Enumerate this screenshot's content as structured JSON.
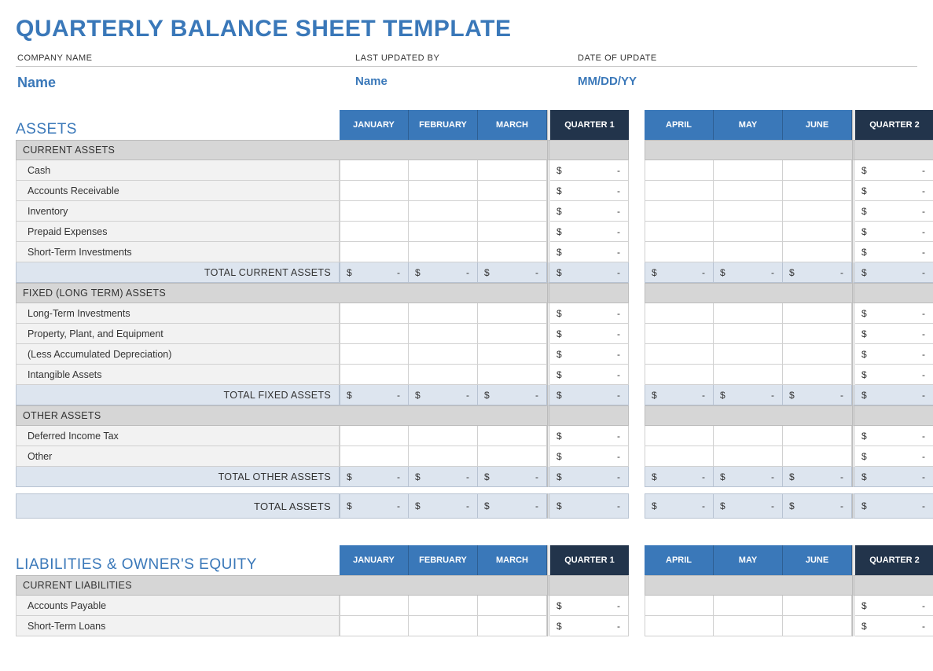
{
  "title": "QUARTERLY BALANCE SHEET TEMPLATE",
  "meta": {
    "labels": {
      "company": "COMPANY NAME",
      "updated_by": "LAST UPDATED BY",
      "date": "DATE OF UPDATE"
    },
    "values": {
      "company": "Name",
      "updated_by": "Name",
      "date": "MM/DD/YY"
    }
  },
  "columns_q1": {
    "m1": "JANUARY",
    "m2": "FEBRUARY",
    "m3": "MARCH",
    "q": "QUARTER 1"
  },
  "columns_q2": {
    "m1": "APRIL",
    "m2": "MAY",
    "m3": "JUNE",
    "q": "QUARTER 2"
  },
  "assets": {
    "heading": "ASSETS",
    "current": {
      "title": "CURRENT ASSETS",
      "rows": [
        "Cash",
        "Accounts Receivable",
        "Inventory",
        "Prepaid Expenses",
        "Short-Term Investments"
      ],
      "total": "TOTAL CURRENT ASSETS"
    },
    "fixed": {
      "title": "FIXED (LONG TERM) ASSETS",
      "rows": [
        "Long-Term Investments",
        "Property, Plant, and Equipment",
        "(Less Accumulated Depreciation)",
        "Intangible Assets"
      ],
      "total": "TOTAL FIXED ASSETS"
    },
    "other": {
      "title": "OTHER ASSETS",
      "rows": [
        "Deferred Income Tax",
        "Other"
      ],
      "total": "TOTAL OTHER ASSETS"
    },
    "grand_total": "TOTAL ASSETS"
  },
  "liabilities": {
    "heading": "LIABILITIES & OWNER'S EQUITY",
    "current": {
      "title": "CURRENT LIABILITIES",
      "rows": [
        "Accounts Payable",
        "Short-Term Loans"
      ]
    }
  }
}
